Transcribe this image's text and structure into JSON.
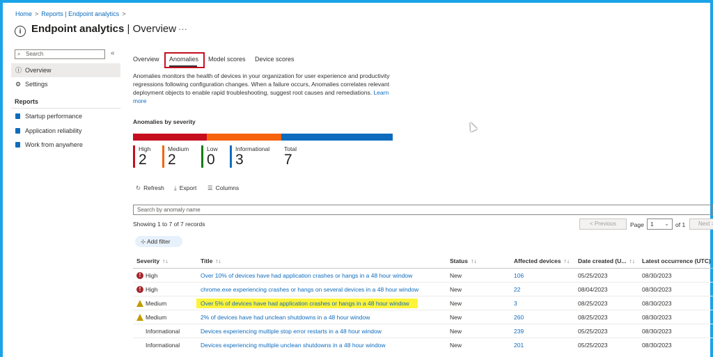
{
  "breadcrumb": [
    {
      "label": "Home"
    },
    {
      "label": "Reports | Endpoint analytics"
    }
  ],
  "header": {
    "title_bold": "Endpoint analytics",
    "title_rest": " | Overview",
    "more": "···"
  },
  "sidebar": {
    "search_placeholder": "Search",
    "collapse": "«",
    "items": [
      {
        "label": "Overview",
        "active": true
      },
      {
        "label": "Settings",
        "active": false
      }
    ],
    "section": "Reports",
    "reports": [
      {
        "label": "Startup performance"
      },
      {
        "label": "Application reliability"
      },
      {
        "label": "Work from anywhere"
      }
    ]
  },
  "tabs": [
    {
      "label": "Overview",
      "active": false
    },
    {
      "label": "Anomalies",
      "active": true
    },
    {
      "label": "Model scores",
      "active": false
    },
    {
      "label": "Device scores",
      "active": false
    }
  ],
  "description": {
    "text": "Anomalies monitors the health of devices in your organization for user experience and productivity regressions following configuration changes. When a failure occurs, Anomalies correlates relevant deployment objects to enable rapid troubleshooting, suggest root causes and remediations.",
    "link": "Learn more"
  },
  "severity": {
    "title": "Anomalies by severity",
    "kpis": [
      {
        "label": "High",
        "value": "2",
        "color": "#c50f1f"
      },
      {
        "label": "Medium",
        "value": "2",
        "color": "#f7630c"
      },
      {
        "label": "Low",
        "value": "0",
        "color": "#107c10"
      },
      {
        "label": "Informational",
        "value": "3",
        "color": "#0f6cbd"
      },
      {
        "label": "Total",
        "value": "7",
        "color": "#ffffff"
      }
    ]
  },
  "toolbar": {
    "refresh": "Refresh",
    "export": "Export",
    "columns": "Columns"
  },
  "table_search_placeholder": "Search by anomaly name",
  "showing": "Showing 1 to 7 of 7 records",
  "pager": {
    "previous": "< Previous",
    "page_label": "Page",
    "page": "1",
    "of": "of 1",
    "next": "Next >"
  },
  "add_filter": "Add filter",
  "columns": [
    "Severity",
    "Title",
    "Status",
    "Affected devices",
    "Date created (U...",
    "Latest occurrence (UTC)"
  ],
  "rows": [
    {
      "severity": "High",
      "title": "Over 10% of devices have had application crashes or hangs in a 48 hour window",
      "status": "New",
      "affected": "106",
      "created": "05/25/2023",
      "latest": "08/30/2023"
    },
    {
      "severity": "High",
      "title": "chrome.exe experiencing crashes or hangs on several devices in a 48 hour window",
      "status": "New",
      "affected": "22",
      "created": "08/04/2023",
      "latest": "08/30/2023"
    },
    {
      "severity": "Medium",
      "title": "Over 5% of devices have had application crashes or hangs in a 48 hour window",
      "status": "New",
      "affected": "3",
      "created": "08/25/2023",
      "latest": "08/30/2023",
      "highlight": true
    },
    {
      "severity": "Medium",
      "title": "2% of devices have had unclean shutdowns in a 48 hour window",
      "status": "New",
      "affected": "260",
      "created": "08/25/2023",
      "latest": "08/30/2023"
    },
    {
      "severity": "Informational",
      "title": "Devices experiencing multiple stop error restarts in a 48 hour window",
      "status": "New",
      "affected": "239",
      "created": "05/25/2023",
      "latest": "08/30/2023"
    },
    {
      "severity": "Informational",
      "title": "Devices experiencing multiple unclean shutdowns in a 48 hour window",
      "status": "New",
      "affected": "201",
      "created": "05/25/2023",
      "latest": "08/30/2023"
    }
  ]
}
